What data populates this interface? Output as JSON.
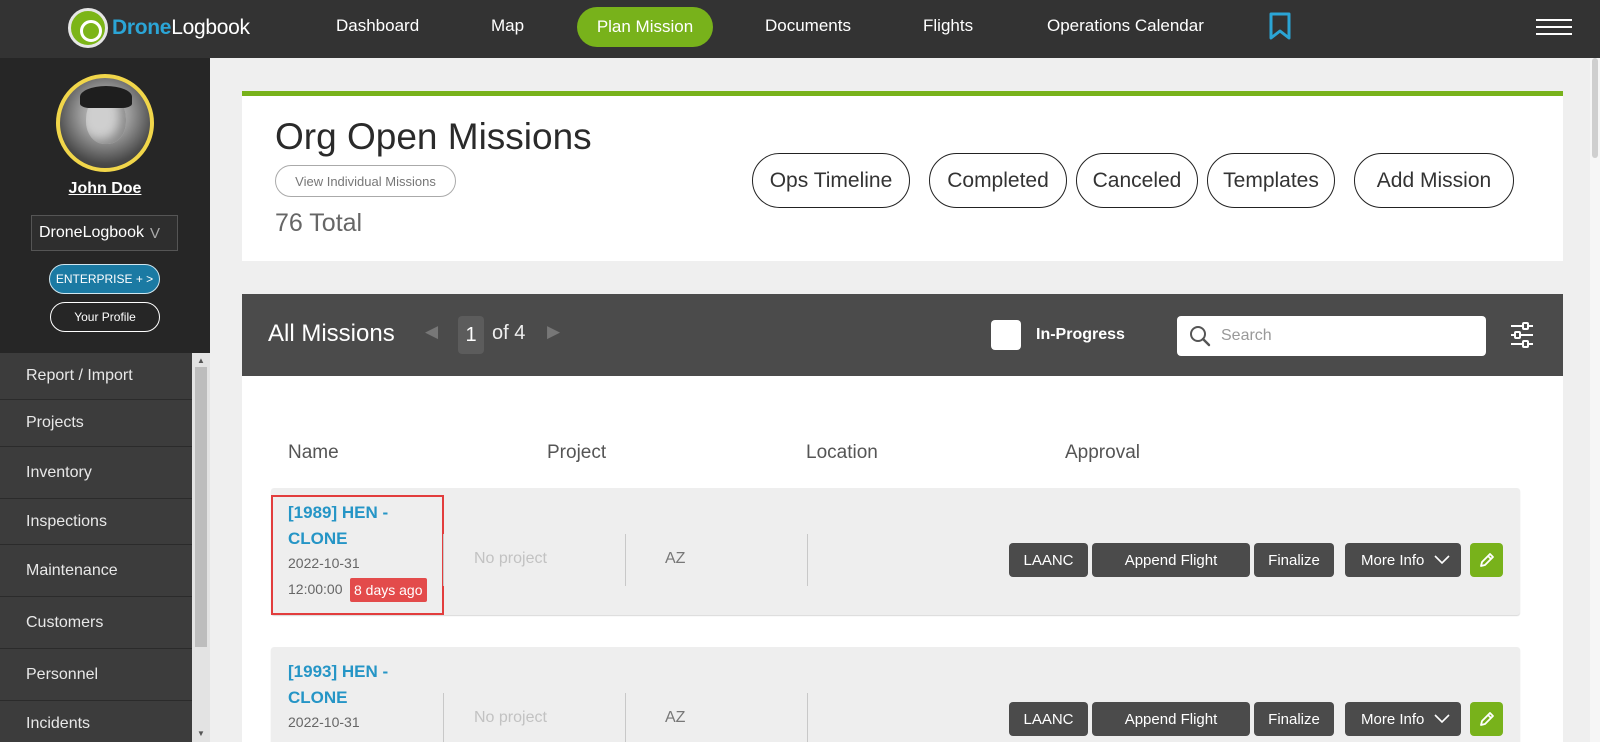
{
  "brand": {
    "name_part1": "Drone",
    "name_part2": "Logbook"
  },
  "nav": {
    "items": [
      "Dashboard",
      "Map",
      "Documents",
      "Flights",
      "Operations Calendar"
    ],
    "active": "Plan Mission"
  },
  "profile": {
    "name": "John Doe",
    "org": "DroneLogbook",
    "org_chevron": "V",
    "enterprise_label": "ENTERPRISE + >",
    "profile_label": "Your Profile"
  },
  "sidebar_menu": [
    "Report / Import",
    "Projects",
    "Inventory",
    "Inspections",
    "Maintenance",
    "Customers",
    "Personnel",
    "Incidents"
  ],
  "header": {
    "title": "Org Open Missions",
    "view_individual": "View Individual Missions",
    "total": "76 Total",
    "buttons": [
      "Ops Timeline",
      "Completed",
      "Canceled",
      "Templates",
      "Add Mission"
    ]
  },
  "list": {
    "title": "All Missions",
    "page": "1",
    "page_of": "of 4",
    "in_progress_label": "In-Progress",
    "search_placeholder": "Search"
  },
  "columns": [
    "Name",
    "Project",
    "Location",
    "Approval"
  ],
  "missions": [
    {
      "name": "[1989] HEN - CLONE",
      "date": "2022-10-31",
      "time": "12:00:00",
      "badge": "8 days ago",
      "project": "No project",
      "location": "AZ"
    },
    {
      "name": "[1993] HEN - CLONE",
      "date": "2022-10-31",
      "time": "",
      "badge": "",
      "project": "No project",
      "location": "AZ"
    }
  ],
  "row_actions": {
    "laanc": "LAANC",
    "append": "Append Flight",
    "finalize": "Finalize",
    "more": "More Info"
  },
  "colors": {
    "accent_green": "#78b21b",
    "brand_blue": "#2ba5d6",
    "link_blue": "#2595c6",
    "badge_red": "#e34b4b"
  }
}
